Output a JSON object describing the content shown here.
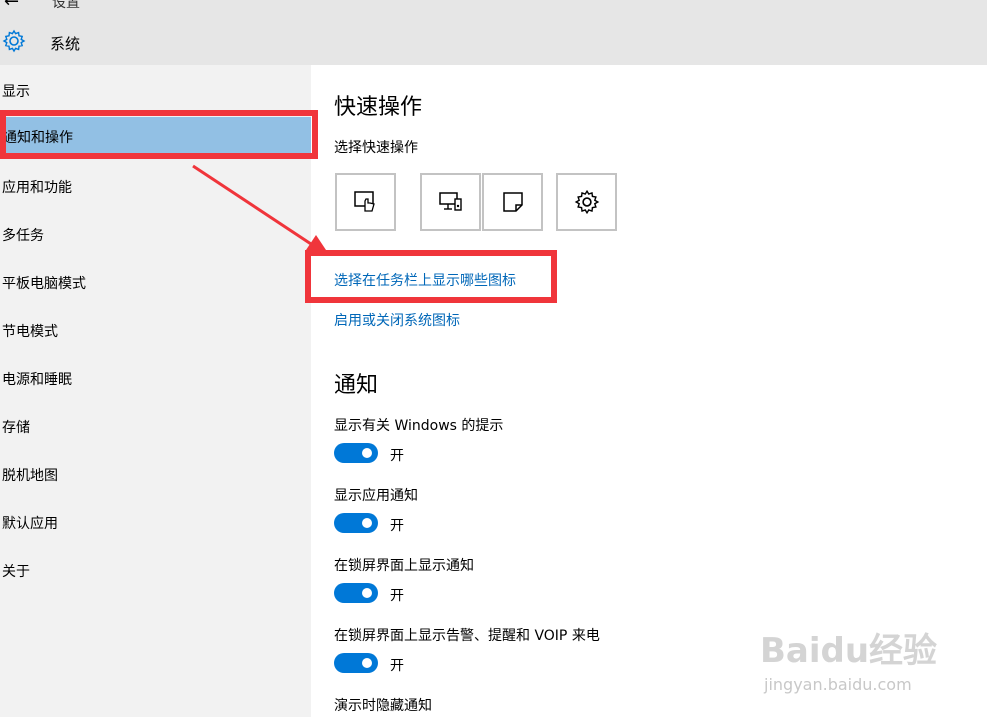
{
  "header": {
    "back_icon": "back-arrow-icon",
    "breadcrumb": "设置",
    "gear_icon": "gear-icon",
    "title": "系统"
  },
  "sidebar": {
    "items": [
      {
        "label": "显示"
      },
      {
        "label": "通知和操作",
        "active": true
      },
      {
        "label": "应用和功能"
      },
      {
        "label": "多任务"
      },
      {
        "label": "平板电脑模式"
      },
      {
        "label": "节电模式"
      },
      {
        "label": "电源和睡眠"
      },
      {
        "label": "存储"
      },
      {
        "label": "脱机地图"
      },
      {
        "label": "默认应用"
      },
      {
        "label": "关于"
      }
    ]
  },
  "main": {
    "quick_actions_heading": "快速操作",
    "choose_quick_actions": "选择快速操作",
    "quick_action_icons": [
      "tablet-mode-icon",
      "project-icon",
      "note-icon",
      "settings-icon"
    ],
    "link_taskbar_icons": "选择在任务栏上显示哪些图标",
    "link_system_icons": "启用或关闭系统图标",
    "notifications_heading": "通知",
    "settings": [
      {
        "label": "显示有关 Windows 的提示",
        "state": "开"
      },
      {
        "label": "显示应用通知",
        "state": "开"
      },
      {
        "label": "在锁屏界面上显示通知",
        "state": "开"
      },
      {
        "label": "在锁屏界面上显示告警、提醒和 VOIP 来电",
        "state": "开"
      },
      {
        "label": "演示时隐藏通知"
      }
    ]
  },
  "watermark": {
    "line1": "Baidu经验",
    "line2": "jingyan.baidu.com"
  },
  "colors": {
    "accent": "#0078d7",
    "link": "#0067b8",
    "highlight": "#92c0e4",
    "annotation": "#f0353b"
  }
}
